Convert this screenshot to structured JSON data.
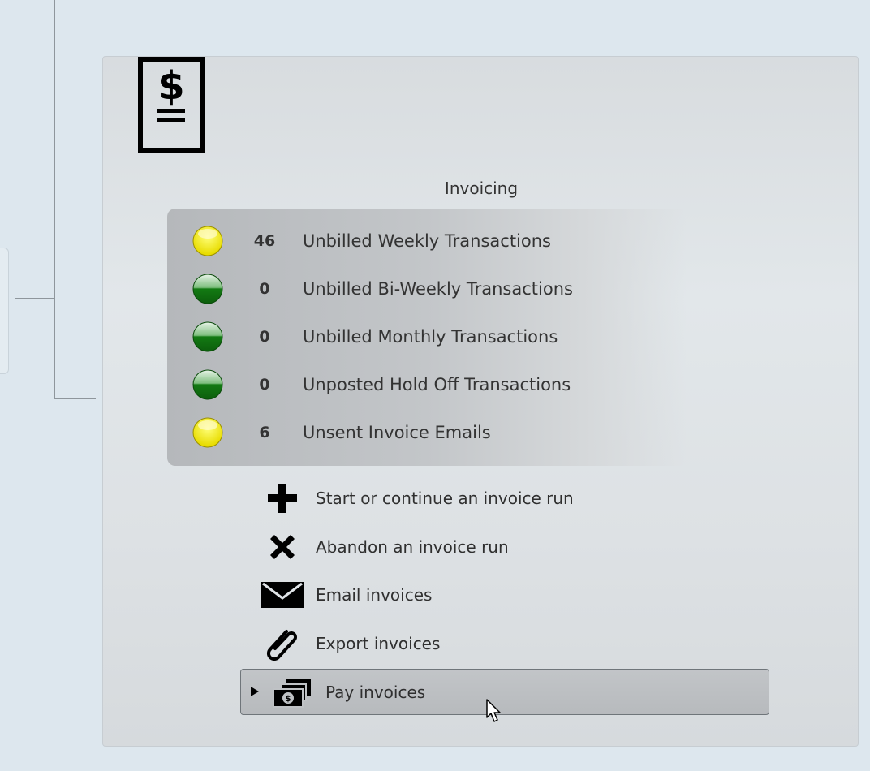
{
  "panel": {
    "title": "Invoicing",
    "icon": "invoice-dollar-icon"
  },
  "status_items": [
    {
      "indicator": "yellow",
      "count": "46",
      "label": "Unbilled Weekly Transactions"
    },
    {
      "indicator": "green",
      "count": "0",
      "label": "Unbilled Bi-Weekly Transactions"
    },
    {
      "indicator": "green",
      "count": "0",
      "label": "Unbilled Monthly Transactions"
    },
    {
      "indicator": "green",
      "count": "0",
      "label": "Unposted Hold Off Transactions"
    },
    {
      "indicator": "yellow",
      "count": "6",
      "label": "Unsent Invoice Emails"
    }
  ],
  "actions": [
    {
      "icon": "plus-icon",
      "label": "Start or continue an invoice run"
    },
    {
      "icon": "close-icon",
      "label": "Abandon an invoice run"
    },
    {
      "icon": "envelope-icon",
      "label": "Email invoices"
    },
    {
      "icon": "paperclip-icon",
      "label": "Export invoices"
    }
  ],
  "pay_button": {
    "label": "Pay invoices",
    "icon": "cash-stack-icon",
    "expand_icon": "triangle-right-icon"
  },
  "colors": {
    "indicator_yellow": "#f5ee0e",
    "indicator_green": "#1f8a1f",
    "page_bg": "#dde7ee"
  }
}
